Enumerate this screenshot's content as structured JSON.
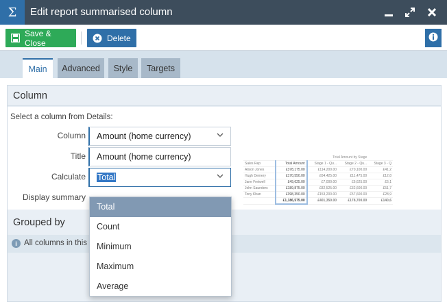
{
  "window": {
    "title": "Edit report summarised column",
    "icon_glyph": "Σ",
    "controls": [
      "minimize-icon",
      "maximize-icon",
      "close-icon"
    ]
  },
  "toolbar": {
    "save_label": "Save & Close",
    "delete_label": "Delete",
    "colors": {
      "save": "#2eaa58",
      "delete": "#2f6fa8"
    }
  },
  "tabs": [
    {
      "label": "Main",
      "active": true
    },
    {
      "label": "Advanced",
      "active": false
    },
    {
      "label": "Style",
      "active": false
    },
    {
      "label": "Targets",
      "active": false
    }
  ],
  "column_section": {
    "heading": "Column",
    "hint": "Select a column from Details:",
    "fields": {
      "column": {
        "label": "Column",
        "value": "Amount (home currency)"
      },
      "title": {
        "label": "Title",
        "value": "Amount (home currency)"
      },
      "calculate": {
        "label": "Calculate",
        "value": "Total"
      },
      "display_summary": {
        "label": "Display summary"
      }
    }
  },
  "preview_table": {
    "group_header": "Total Amount by Stage",
    "headers": [
      "Sales Rep",
      "Total Amount",
      "Stage 1 - Qu...",
      "Stage 2 - Qu...",
      "Stage 3 - Q"
    ],
    "rows": [
      [
        "Alison Jones",
        "£378,175.00",
        "£114,200.00",
        "£70,100.00",
        "£41,2"
      ],
      [
        "Hugh Demery",
        "£170,550.00",
        "£64,425.00",
        "£11,475.00",
        "£12,8"
      ],
      [
        "Jane Fretwell",
        "£49,625.00",
        "£7,000.00",
        "£6,625.00",
        "£6,1"
      ],
      [
        "John Saunders",
        "£189,875.00",
        "£82,525.00",
        "£32,600.00",
        "£51,7"
      ],
      [
        "Tony Khan",
        "£398,350.00",
        "£153,200.00",
        "£57,600.00",
        "£28,9"
      ]
    ],
    "total_row": [
      "",
      "£1,186,575.00",
      "£401,350.00",
      "£178,700.00",
      "£140,6"
    ]
  },
  "grouped_section": {
    "heading": "Grouped by",
    "info_text": "All columns in this"
  },
  "calculate_dropdown": {
    "options": [
      "Total",
      "Count",
      "Minimum",
      "Maximum",
      "Average"
    ],
    "selected": "Total"
  }
}
